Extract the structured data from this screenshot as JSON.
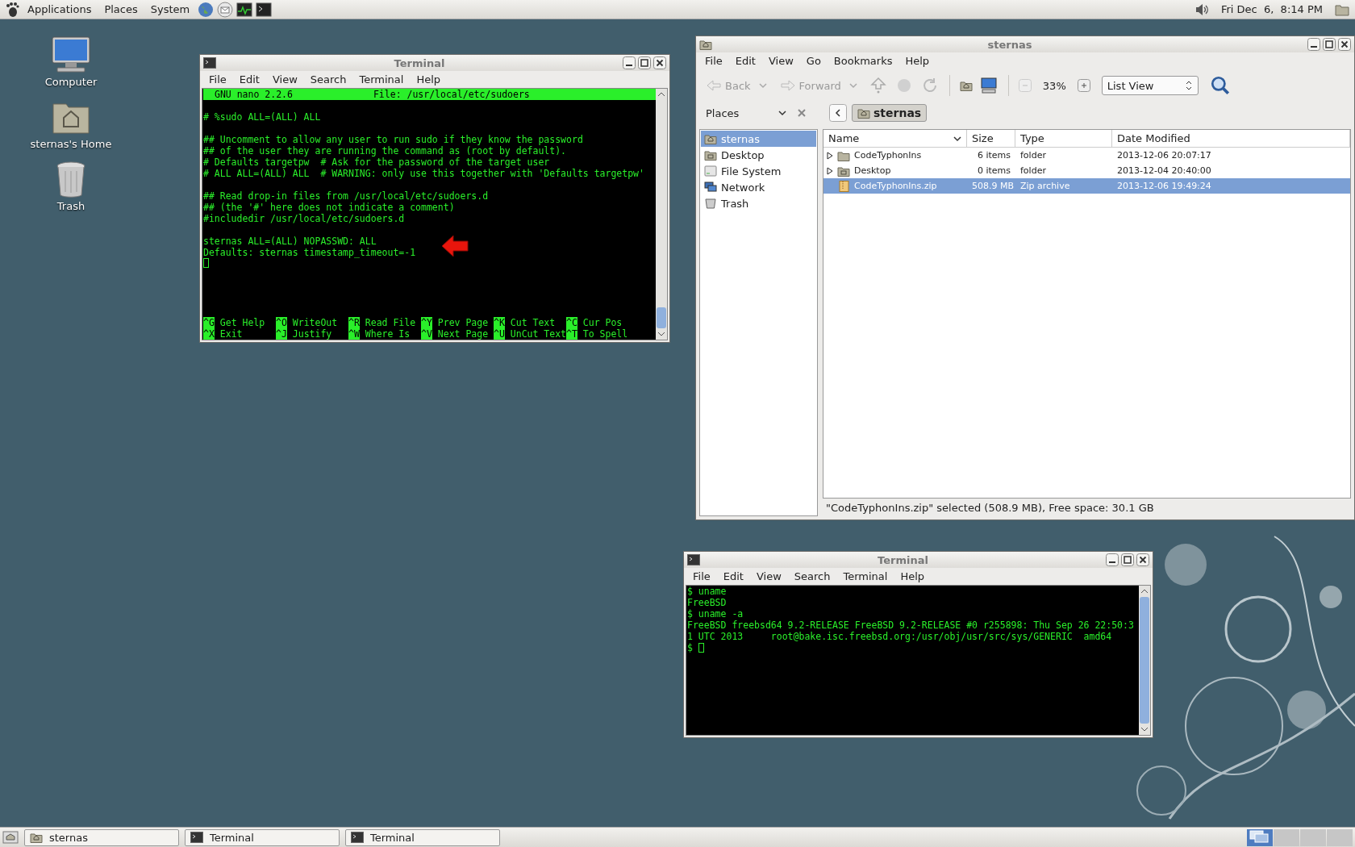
{
  "top_panel": {
    "menus": [
      "Applications",
      "Places",
      "System"
    ],
    "clock": "Fri Dec  6,  8:14 PM"
  },
  "desktop_icons": [
    {
      "label": "Computer",
      "kind": "computer"
    },
    {
      "label": "sternas's Home",
      "kind": "home"
    },
    {
      "label": "Trash",
      "kind": "trash"
    }
  ],
  "nano_terminal": {
    "title": "Terminal",
    "menu": [
      "File",
      "Edit",
      "View",
      "Search",
      "Terminal",
      "Help"
    ],
    "header": {
      "version": "GNU nano 2.2.6",
      "file": "File: /usr/local/etc/sudoers"
    },
    "blocks": [
      [
        "# %sudo ALL=(ALL) ALL"
      ],
      [
        "## Uncomment to allow any user to run sudo if they know the password",
        "## of the user they are running the command as (root by default).",
        "# Defaults targetpw  # Ask for the password of the target user",
        "# ALL ALL=(ALL) ALL  # WARNING: only use this together with 'Defaults targetpw'"
      ],
      [
        "## Read drop-in files from /usr/local/etc/sudoers.d",
        "## (the '#' here does not indicate a comment)",
        "#includedir /usr/local/etc/sudoers.d"
      ],
      [
        "sternas ALL=(ALL) NOPASSWD: ALL",
        "Defaults: sternas timestamp_timeout=-1"
      ]
    ],
    "cursor": true,
    "shortcuts": [
      [
        {
          "key": "^G",
          "label": "Get Help"
        },
        {
          "key": "^O",
          "label": "WriteOut"
        },
        {
          "key": "^R",
          "label": "Read File"
        },
        {
          "key": "^Y",
          "label": "Prev Page"
        },
        {
          "key": "^K",
          "label": "Cut Text"
        },
        {
          "key": "^C",
          "label": "Cur Pos"
        }
      ],
      [
        {
          "key": "^X",
          "label": "Exit"
        },
        {
          "key": "^J",
          "label": "Justify"
        },
        {
          "key": "^W",
          "label": "Where Is"
        },
        {
          "key": "^V",
          "label": "Next Page"
        },
        {
          "key": "^U",
          "label": "UnCut Text"
        },
        {
          "key": "^T",
          "label": "To Spell"
        }
      ]
    ]
  },
  "file_manager": {
    "title": "sternas",
    "menu": [
      "File",
      "Edit",
      "View",
      "Go",
      "Bookmarks",
      "Help"
    ],
    "toolbar": {
      "back": {
        "label": "Back",
        "disabled": true
      },
      "forward": {
        "label": "Forward",
        "disabled": true
      },
      "zoom": "33%",
      "view": "List View"
    },
    "places_label": "Places",
    "path": "sternas",
    "sidebar": [
      {
        "label": "sternas",
        "kind": "home",
        "selected": true
      },
      {
        "label": "Desktop",
        "kind": "desktop",
        "selected": false
      },
      {
        "label": "File System",
        "kind": "drive",
        "selected": false
      },
      {
        "label": "Network",
        "kind": "network",
        "selected": false
      },
      {
        "label": "Trash",
        "kind": "trash",
        "selected": false
      }
    ],
    "columns": [
      "Name",
      "Size",
      "Type",
      "Date Modified"
    ],
    "rows": [
      {
        "kind": "folder",
        "name": "CodeTyphonIns",
        "size": "6 items",
        "type": "folder",
        "date": "2013-12-06 20:07:17",
        "selected": false
      },
      {
        "kind": "desktop",
        "name": "Desktop",
        "size": "0 items",
        "type": "folder",
        "date": "2013-12-04 20:40:00",
        "selected": false
      },
      {
        "kind": "zip",
        "name": "CodeTyphonIns.zip",
        "size": "508.9 MB",
        "type": "Zip archive",
        "date": "2013-12-06 19:49:24",
        "selected": true
      }
    ],
    "status": "\"CodeTyphonIns.zip\" selected (508.9 MB), Free space: 30.1 GB"
  },
  "shell_terminal": {
    "title": "Terminal",
    "menu": [
      "File",
      "Edit",
      "View",
      "Search",
      "Terminal",
      "Help"
    ],
    "lines": [
      {
        "text": "$ uname",
        "cursor": false
      },
      {
        "text": "FreeBSD",
        "cursor": false
      },
      {
        "text": "$ uname -a",
        "cursor": false
      },
      {
        "text": "FreeBSD freebsd64 9.2-RELEASE FreeBSD 9.2-RELEASE #0 r255898: Thu Sep 26 22:50:3",
        "cursor": false
      },
      {
        "text": "1 UTC 2013     root@bake.isc.freebsd.org:/usr/obj/usr/src/sys/GENERIC  amd64",
        "cursor": false
      },
      {
        "text": "$",
        "cursor": true
      }
    ]
  },
  "taskbar": {
    "tasks": [
      {
        "label": "sternas",
        "kind": "folder"
      },
      {
        "label": "Terminal",
        "kind": "terminal"
      },
      {
        "label": "Terminal",
        "kind": "terminal"
      }
    ],
    "workspaces": [
      {
        "selected": true
      },
      {
        "selected": false
      },
      {
        "selected": false
      },
      {
        "selected": false
      }
    ]
  }
}
